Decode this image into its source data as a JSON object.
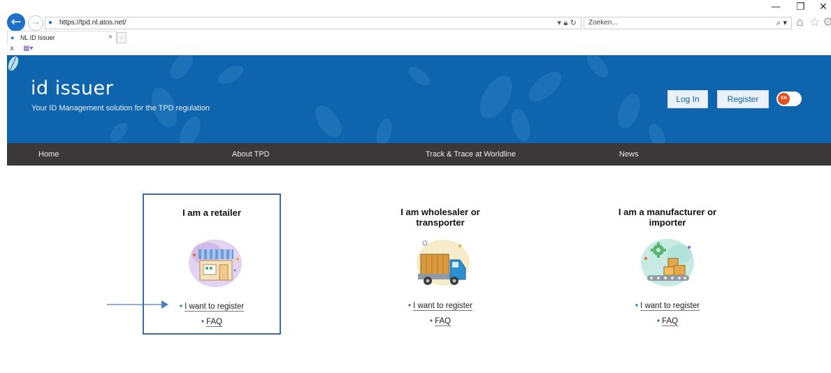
{
  "browser": {
    "window_controls": {
      "minimize": "—",
      "restore": "❐",
      "close": "✕"
    },
    "address_url": "https://tpd.nl.atos.net/",
    "search_placeholder": "Zoeken...",
    "tab_title": "NL ID Issuer",
    "tab_close": "×",
    "favorites_close": "x",
    "icons": [
      "back-arrow-icon",
      "forward-arrow-icon",
      "ie-icon",
      "padlock-icon",
      "refresh-icon",
      "search-icon",
      "home-icon",
      "star-icon",
      "gear-icon"
    ]
  },
  "site": {
    "logo": "id issuer",
    "tagline": "Your ID Management solution for the TPD regulation",
    "login_label": "Log In",
    "register_label": "Register",
    "lang": "EN",
    "colors": {
      "header_blue": "#0e64ad",
      "nav_dark": "#3a3838",
      "link_dot": "#1b6fc2",
      "lang_badge": "#e0501f"
    }
  },
  "nav": {
    "items": [
      "Home",
      "About TPD",
      "Track & Trace at Worldline",
      "News"
    ]
  },
  "cards": [
    {
      "title_lines": [
        "I am a retailer"
      ],
      "register_link": "I want to register",
      "faq_link": "FAQ",
      "icon": "shop-icon"
    },
    {
      "title_lines": [
        "I am wholesaler or",
        "transporter"
      ],
      "register_link": "I want to register",
      "faq_link": "FAQ",
      "icon": "truck-icon"
    },
    {
      "title_lines": [
        "I am a manufacturer or",
        "importer"
      ],
      "register_link": "I want to register",
      "faq_link": "FAQ",
      "icon": "conveyor-icon"
    }
  ]
}
